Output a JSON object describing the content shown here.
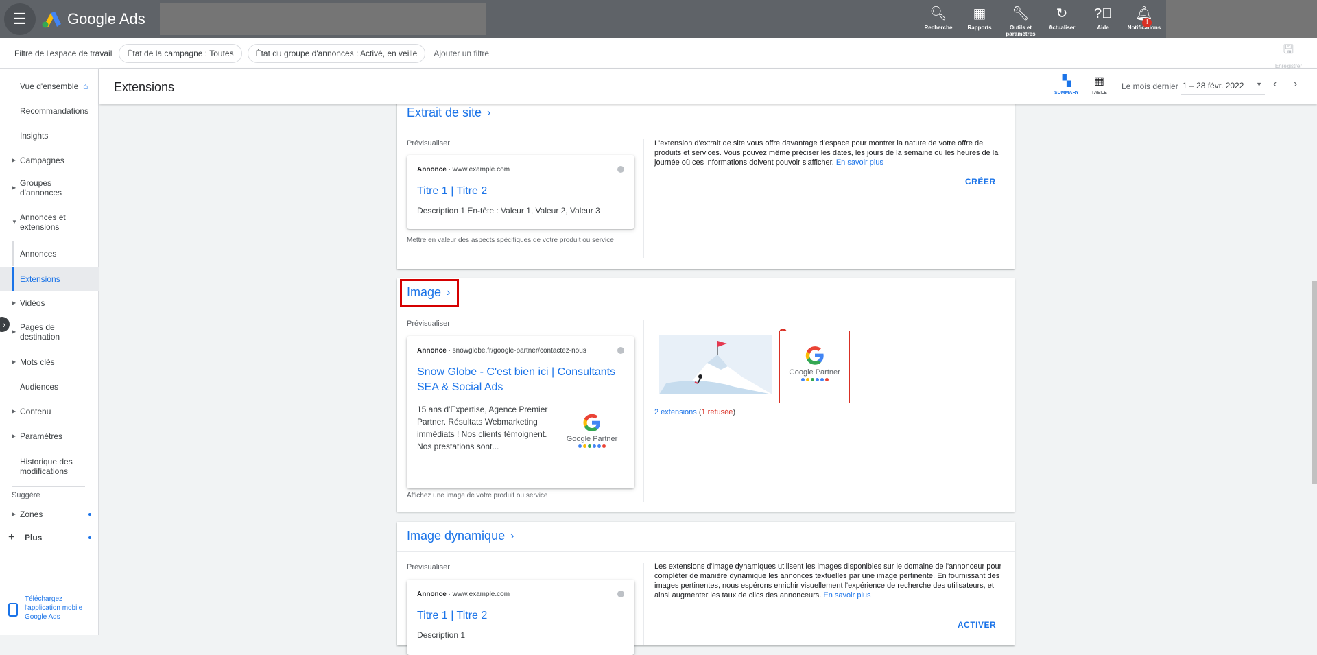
{
  "topbar": {
    "app_name": "Google Ads",
    "actions": [
      {
        "label": "Recherche",
        "icon": "search-icon"
      },
      {
        "label": "Rapports",
        "icon": "reports-icon"
      },
      {
        "label": "Outils et paramètres",
        "icon": "tools-icon"
      },
      {
        "label": "Actualiser",
        "icon": "refresh-icon"
      },
      {
        "label": "Aide",
        "icon": "help-icon"
      },
      {
        "label": "Notifications",
        "icon": "bell-icon",
        "badge": "!"
      }
    ]
  },
  "filterbar": {
    "label": "Filtre de l'espace de travail",
    "chips": [
      "État de la campagne : Toutes",
      "État du groupe d'annonces : Activé, en veille"
    ],
    "add_filter": "Ajouter un filtre",
    "save": "Enregistrer"
  },
  "sidebar": {
    "items": [
      {
        "label": "Vue d'ensemble"
      },
      {
        "label": "Recommandations"
      },
      {
        "label": "Insights"
      },
      {
        "label": "Campagnes"
      },
      {
        "label": "Groupes d'annonces"
      },
      {
        "label": "Annonces et extensions"
      },
      {
        "label": "Annonces"
      },
      {
        "label": "Extensions"
      },
      {
        "label": "Vidéos"
      },
      {
        "label": "Pages de destination"
      },
      {
        "label": "Mots clés"
      },
      {
        "label": "Audiences"
      },
      {
        "label": "Contenu"
      },
      {
        "label": "Paramètres"
      },
      {
        "label": "Historique des modifications"
      }
    ],
    "suggested_header": "Suggéré",
    "suggested": [
      {
        "label": "Zones"
      },
      {
        "label": "Plus"
      }
    ],
    "mobile_promo": "Téléchargez l'application mobile Google Ads"
  },
  "header": {
    "title": "Extensions",
    "view_summary": "SUMMARY",
    "view_table": "TABLE",
    "period_label": "Le mois dernier",
    "date_range": "1 – 28 févr. 2022"
  },
  "cards": {
    "sitelink": {
      "title": "Extrait de site",
      "preview_label": "Prévisualiser",
      "ad_label": "Annonce",
      "ad_url": "www.example.com",
      "ad_title": "Titre 1 | Titre 2",
      "ad_desc": "Description 1 En-tête : Valeur 1, Valeur 2, Valeur 3",
      "footer": "Mettre en valeur des aspects spécifiques de votre produit ou service",
      "info": "L'extension d'extrait de site vous offre davantage d'espace pour montrer la nature de votre offre de produits et services. Vous pouvez même préciser les dates, les jours de la semaine ou les heures de la journée où ces informations doivent pouvoir s'afficher.",
      "learn_more": "En savoir plus",
      "action": "CRÉER"
    },
    "image": {
      "title": "Image",
      "preview_label": "Prévisualiser",
      "ad_label": "Annonce",
      "ad_url": "snowglobe.fr/google-partner/contactez-nous",
      "ad_title": "Snow Globe - C'est bien ici | Consultants SEA & Social Ads",
      "ad_desc": "15 ans d'Expertise, Agence Premier Partner. Résultats Webmarketing immédiats ! Nos clients témoignent. Nos prestations sont...",
      "footer": "Affichez une image de votre produit ou service",
      "partner_text": "Google Partner",
      "ext_count": "2 extensions",
      "ext_refused": "1 refusée",
      "error_badge": "!"
    },
    "dynamic": {
      "title": "Image dynamique",
      "preview_label": "Prévisualiser",
      "ad_label": "Annonce",
      "ad_url": "www.example.com",
      "ad_title": "Titre 1 | Titre 2",
      "ad_desc": "Description 1",
      "info": "Les extensions d'image dynamiques utilisent les images disponibles sur le domaine de l'annonceur pour compléter de manière dynamique les annonces textuelles par une image pertinente. En fournissant des images pertinentes, nous espérons enrichir visuellement l'expérience de recherche des utilisateurs, et ainsi augmenter les taux de clics des annonceurs.",
      "learn_more": "En savoir plus",
      "action": "ACTIVER"
    }
  },
  "colors": {
    "topbar": "#5f6368",
    "accent": "#1a73e8",
    "error": "#d93025",
    "highlight": "#d50000"
  }
}
